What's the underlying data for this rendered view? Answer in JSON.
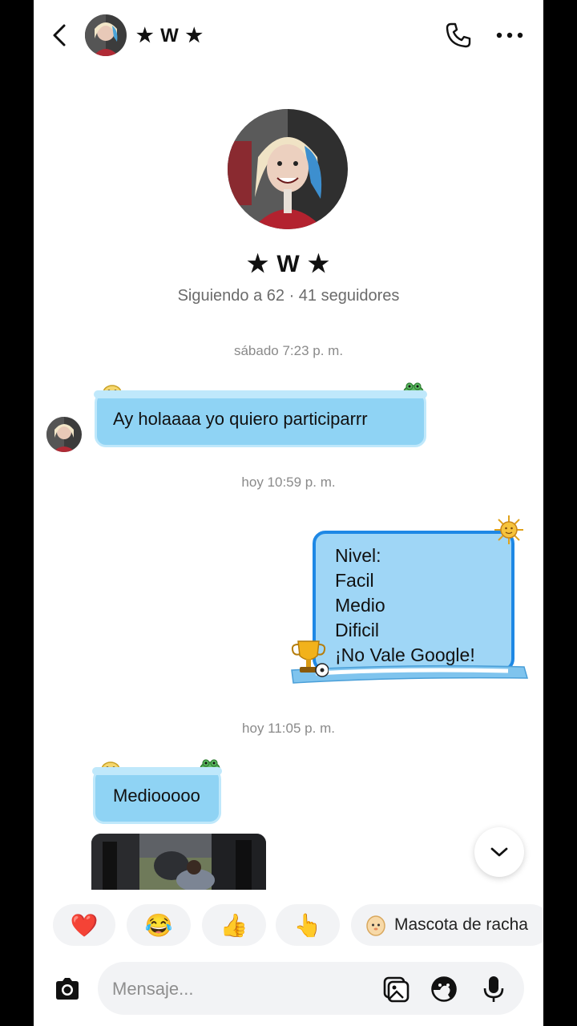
{
  "header": {
    "contact_name": "★ W ★"
  },
  "profile": {
    "name": "★ W ★",
    "stats": "Siguiendo a 62 · 41 seguidores"
  },
  "timestamps": {
    "first": "sábado 7:23 p. m.",
    "second": "hoy 10:59 p. m.",
    "third": "hoy 11:05 p. m."
  },
  "messages": {
    "incoming_1": "Ay holaaaa yo quiero participarrr",
    "outgoing_lines": [
      "Nivel:",
      "Facil",
      "Medio",
      "Dificil",
      "¡No Vale Google!"
    ],
    "incoming_2": "Mediooooo"
  },
  "reactions": {
    "heart": "❤️",
    "laugh": "😂",
    "thumbs_up": "👍",
    "pointing": "👆",
    "streak_pet_label": "Mascota de racha"
  },
  "composer": {
    "placeholder": "Mensaje..."
  },
  "icons": {
    "back": "chevron-left-icon",
    "call": "phone-icon",
    "more": "more-horizontal-icon",
    "camera": "camera-icon",
    "gallery": "gallery-icon",
    "sticker": "sticker-icon",
    "mic": "microphone-icon",
    "scroll": "chevron-down-icon"
  },
  "colors": {
    "bubble_blue": "#8fd3f4",
    "bubble_outline": "#1e88e5",
    "heart_red": "#e0245e"
  }
}
